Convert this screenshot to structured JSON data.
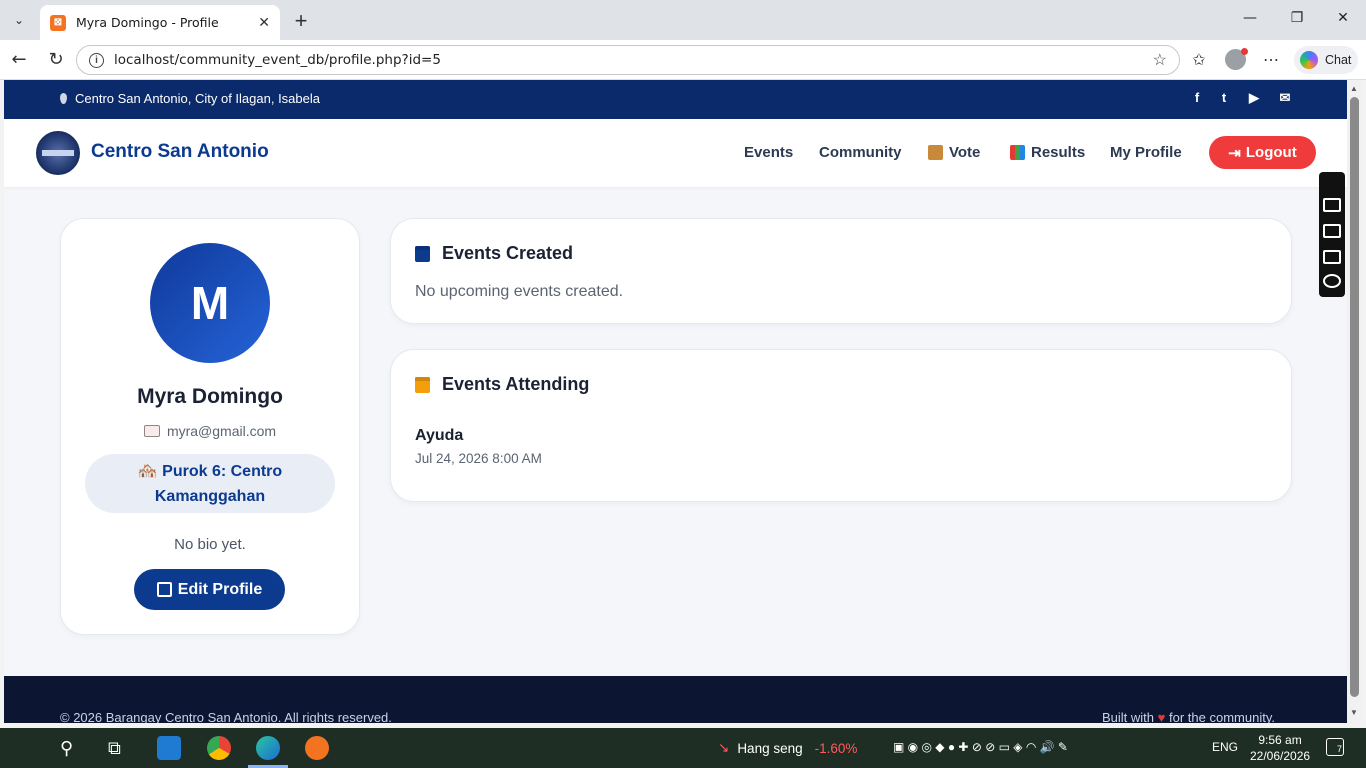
{
  "browser": {
    "tab_title": "Myra Domingo - Profile",
    "url": "localhost/community_event_db/profile.php?id=5",
    "chat_label": "Chat"
  },
  "site": {
    "location": "Centro San Antonio, City of Ilagan, Isabela",
    "brand": "Centro San Antonio",
    "social": [
      "f",
      "t",
      "▶",
      "✉"
    ],
    "nav": {
      "events": "Events",
      "community": "Community",
      "vote": "Vote",
      "results": "Results",
      "my_profile": "My Profile",
      "logout": "Logout"
    }
  },
  "profile": {
    "initial": "M",
    "name": "Myra Domingo",
    "email": "myra@gmail.com",
    "purok": "🏘️ Purok 6: Centro Kamanggahan",
    "bio": "No bio yet.",
    "edit_label": "Edit Profile"
  },
  "events_created": {
    "title": "Events Created",
    "empty_text": "No upcoming events created.",
    "icon_color": "#0b3a8f"
  },
  "events_attending": {
    "title": "Events Attending",
    "icon_color": "#f59e0b",
    "items": [
      {
        "name": "Ayuda",
        "date": "Jul 24, 2026 8:00 AM"
      }
    ]
  },
  "footer": {
    "copyright": "© 2026 Barangay Centro San Antonio. All rights reserved.",
    "built_prefix": "Built with",
    "heart": "♥",
    "built_suffix": "for the community."
  },
  "taskbar": {
    "ticker_name": "Hang seng",
    "ticker_change": "-1.60%",
    "language": "ENG",
    "time": "9:56 am",
    "date": "22/06/2026",
    "notification_count": "7"
  },
  "colors": {
    "brand_blue": "#0b3a8f",
    "logout_red": "#ef3b3b",
    "top_strip": "#0b2a6b",
    "footer": "#0c1633"
  }
}
